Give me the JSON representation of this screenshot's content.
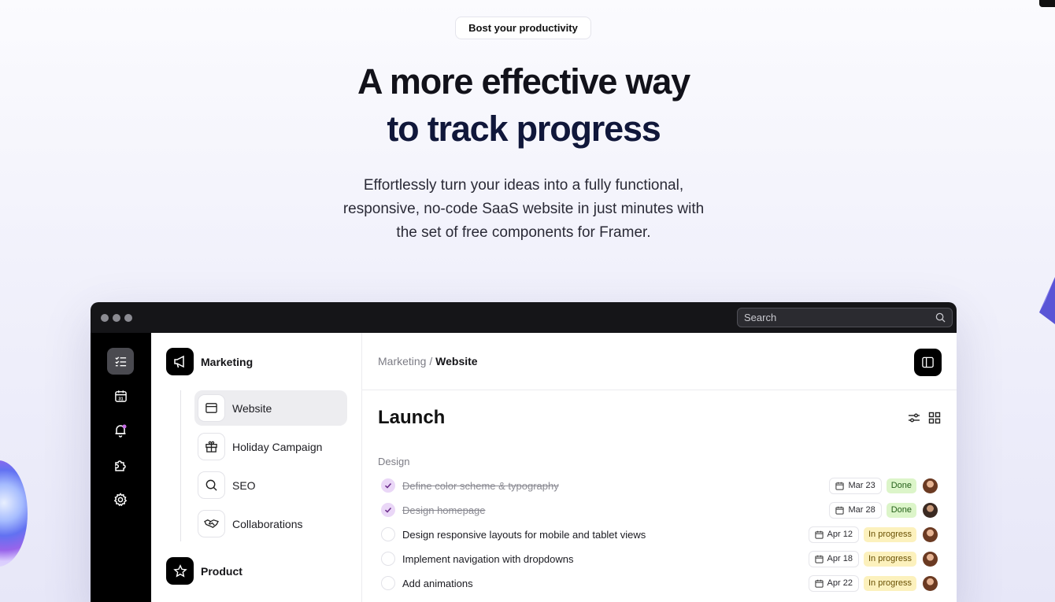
{
  "hero": {
    "badge": "Bost your productivity",
    "title_line1": "A more effective way",
    "title_line2": "to track progress",
    "subtitle_lines": [
      "Effortlessly turn your ideas into a fully functional,",
      "responsive, no-code SaaS website in just minutes with",
      "the set of free components for Framer."
    ]
  },
  "app": {
    "search_placeholder": "Search",
    "rail_icons": [
      "tasks-icon",
      "calendar-icon",
      "bell-icon",
      "puzzle-icon",
      "settings-icon"
    ],
    "calendar_day": "31",
    "nav": {
      "group1": "Marketing",
      "items": [
        {
          "label": "Website",
          "icon": "browser-icon"
        },
        {
          "label": "Holiday Campaign",
          "icon": "gift-icon"
        },
        {
          "label": "SEO",
          "icon": "search-icon"
        },
        {
          "label": "Collaborations",
          "icon": "handshake-icon"
        }
      ],
      "group2": "Product"
    },
    "breadcrumb": {
      "parent": "Marketing",
      "separator": " / ",
      "current": "Website"
    },
    "project_title": "Launch",
    "section_title": "Design",
    "tasks": [
      {
        "title": "Define color scheme & typography",
        "date": "Mar 23",
        "status": "Done",
        "done": true
      },
      {
        "title": "Design homepage",
        "date": "Mar 28",
        "status": "Done",
        "done": true
      },
      {
        "title": "Design responsive layouts for mobile and tablet views",
        "date": "Apr 12",
        "status": "In progress",
        "done": false
      },
      {
        "title": "Implement navigation with dropdowns",
        "date": "Apr 18",
        "status": "In progress",
        "done": false
      },
      {
        "title": "Add animations",
        "date": "Apr 22",
        "status": "In progress",
        "done": false
      }
    ],
    "colors": {
      "accent_check": "#ead7f7",
      "done_badge": "#dcf5c9",
      "progress_badge": "#fcf1bd"
    }
  }
}
